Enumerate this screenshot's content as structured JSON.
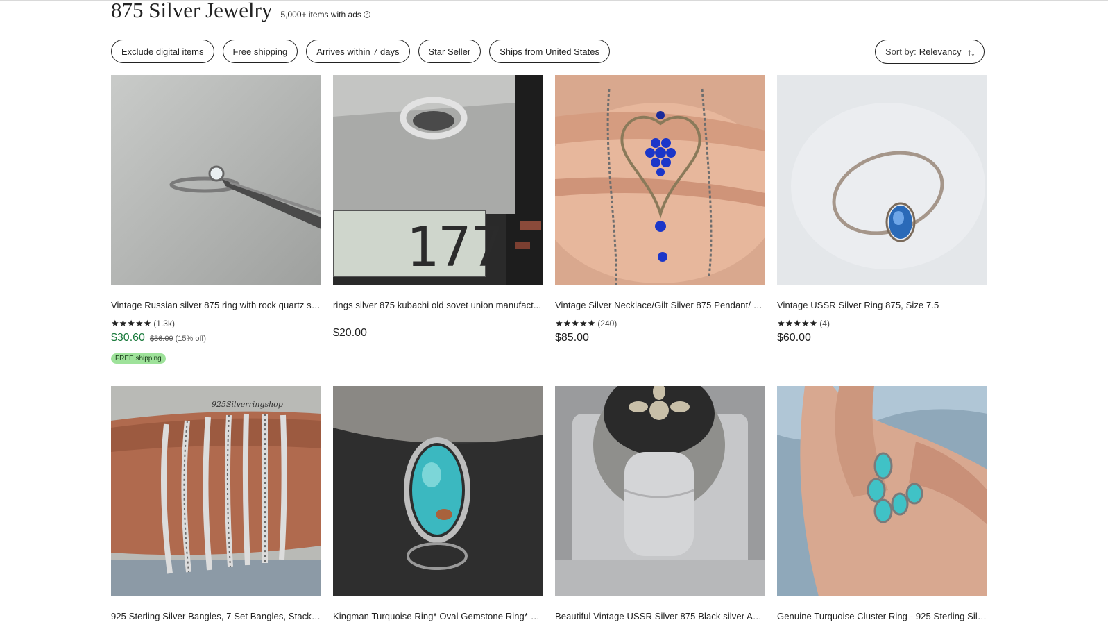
{
  "header": {
    "title": "875 Silver Jewelry",
    "count": "5,000+ items with ads",
    "info_icon": "question-circle-icon"
  },
  "filters": [
    "Exclude digital items",
    "Free shipping",
    "Arrives within 7 days",
    "Star Seller",
    "Ships from United States"
  ],
  "sort": {
    "label": "Sort by:",
    "value": "Relevancy",
    "icon": "sort-arrows-icon"
  },
  "listings": [
    {
      "title": "Vintage Russian silver 875 ring with rock quartz st...",
      "stars": "★★★★★",
      "reviews": "(1.3k)",
      "price": "$30.60",
      "original_price": "$36.00",
      "discount": "(15% off)",
      "badge": "FREE shipping"
    },
    {
      "title": "rings silver 875 kubachi old sovet union manufact...",
      "price": "$20.00"
    },
    {
      "title": "Vintage Silver Necklace/Gilt Silver 875 Pendant/ S...",
      "stars": "★★★★★",
      "reviews": "(240)",
      "price": "$85.00"
    },
    {
      "title": "Vintage USSR Silver Ring 875, Size 7.5",
      "stars": "★★★★★",
      "reviews": "(4)",
      "price": "$60.00"
    },
    {
      "title": "925 Sterling Silver Bangles, 7 Set Bangles, Stacka...",
      "watermark": "925Silverringshop"
    },
    {
      "title": "Kingman Turquoise Ring* Oval Gemstone Ring* B..."
    },
    {
      "title": "Beautiful Vintage USSR Silver 875 Black silver Aw..."
    },
    {
      "title": "Genuine Turquoise Cluster Ring - 925 Sterling Silv..."
    }
  ],
  "scale_display": "177",
  "colors": {
    "sale_price": "#1a7a3c",
    "free_shipping_badge": "#9ee29a",
    "text": "#222222"
  }
}
